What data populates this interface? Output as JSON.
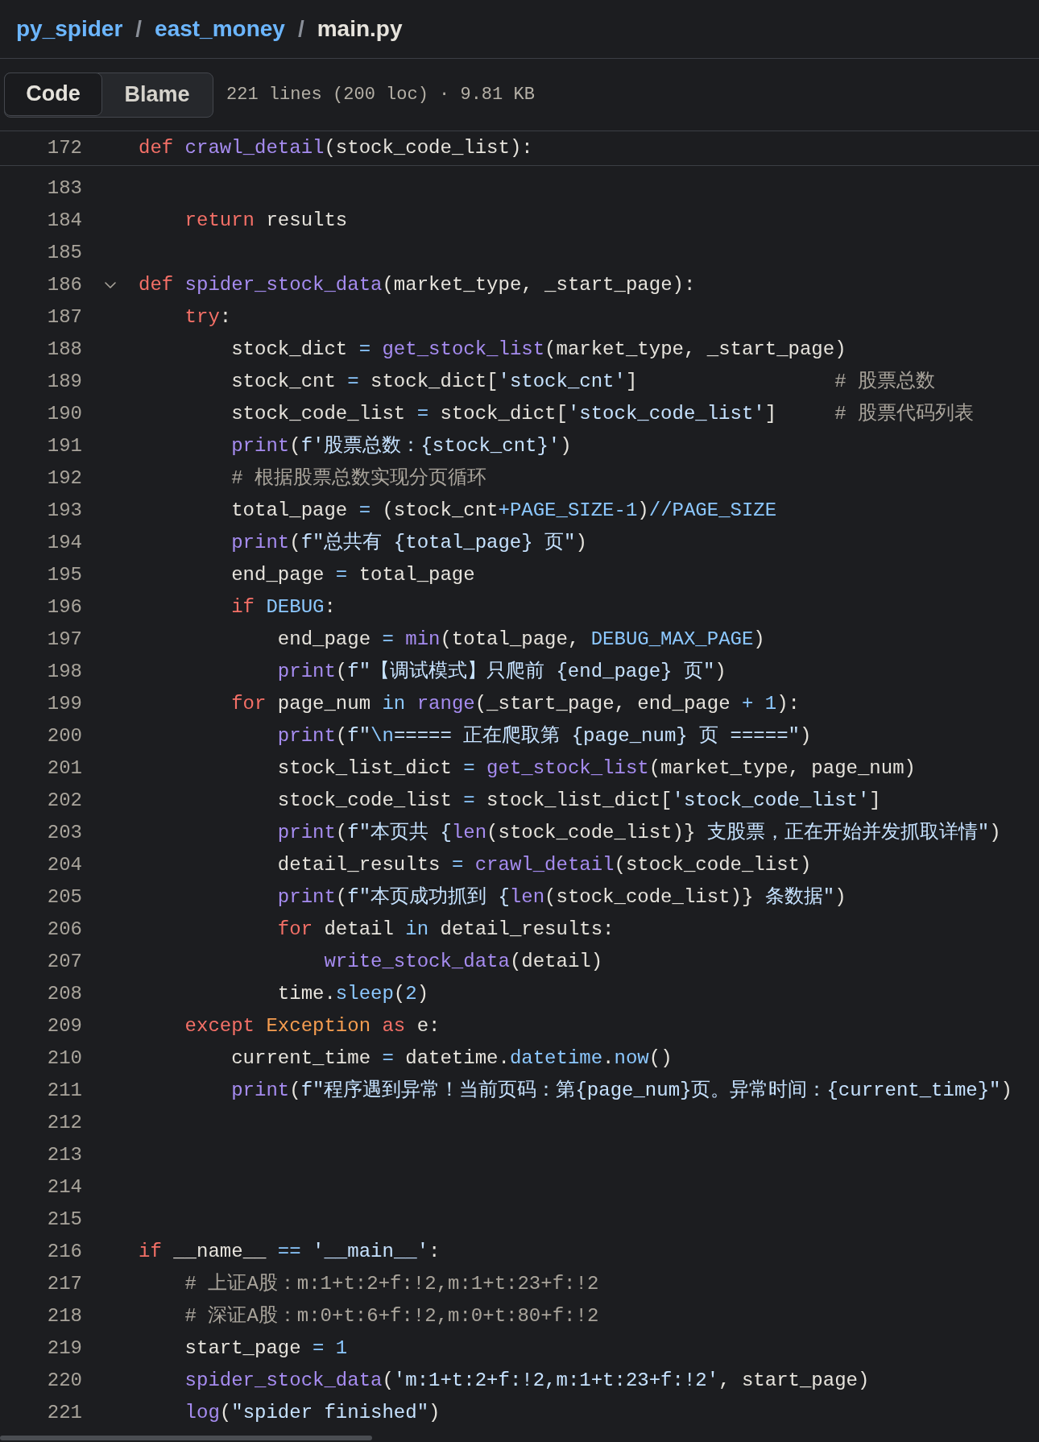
{
  "breadcrumb": [
    {
      "kind": "link",
      "label": "py_spider"
    },
    {
      "kind": "separator",
      "label": "/"
    },
    {
      "kind": "link",
      "label": "east_money"
    },
    {
      "kind": "separator",
      "label": "/"
    },
    {
      "kind": "current",
      "label": "main.py"
    }
  ],
  "view_tabs": [
    {
      "label": "Code",
      "selected": true
    },
    {
      "label": "Blame",
      "selected": false
    }
  ],
  "file_info": "221 lines (200 loc) · 9.81 KB",
  "sticky_line": {
    "number": "172",
    "tokens": [
      {
        "kind": "k",
        "text": "def"
      },
      {
        "kind": "f",
        "text": " crawl_detail"
      },
      {
        "kind": "p",
        "text": "(stock_code_list):"
      }
    ]
  },
  "lines": [
    {
      "number": "183"
    },
    {
      "number": "184",
      "tokens": [
        {
          "kind": "k",
          "text": "    return"
        },
        {
          "kind": "p",
          "text": " results"
        }
      ]
    },
    {
      "number": "185"
    },
    {
      "number": "186",
      "expanded": true,
      "tokens": [
        {
          "kind": "k",
          "text": "def"
        },
        {
          "kind": "f",
          "text": " spider_stock_data"
        },
        {
          "kind": "p",
          "text": "(market_type, _start_page):"
        }
      ]
    },
    {
      "number": "187",
      "tokens": [
        {
          "kind": "k",
          "text": "    try"
        },
        {
          "kind": "p",
          "text": ":"
        }
      ]
    },
    {
      "number": "188",
      "tokens": [
        {
          "kind": "p",
          "text": "        stock_dict "
        },
        {
          "kind": "c",
          "text": "="
        },
        {
          "kind": "f",
          "text": " get_stock_list"
        },
        {
          "kind": "p",
          "text": "(market_type, _start_page)"
        }
      ]
    },
    {
      "number": "189",
      "tokens": [
        {
          "kind": "p",
          "text": "        stock_cnt "
        },
        {
          "kind": "c",
          "text": "="
        },
        {
          "kind": "p",
          "text": " stock_dict["
        },
        {
          "kind": "s",
          "text": "'stock_cnt'"
        },
        {
          "kind": "p",
          "text": "]"
        },
        {
          "kind": "m",
          "text": "                 # 股票总数"
        }
      ]
    },
    {
      "number": "190",
      "tokens": [
        {
          "kind": "p",
          "text": "        stock_code_list "
        },
        {
          "kind": "c",
          "text": "="
        },
        {
          "kind": "p",
          "text": " stock_dict["
        },
        {
          "kind": "s",
          "text": "'stock_code_list'"
        },
        {
          "kind": "p",
          "text": "]"
        },
        {
          "kind": "m",
          "text": "     # 股票代码列表"
        }
      ]
    },
    {
      "number": "191",
      "tokens": [
        {
          "kind": "f",
          "text": "        print"
        },
        {
          "kind": "p",
          "text": "("
        },
        {
          "kind": "s",
          "text": "f'股票总数：{stock_cnt}'"
        },
        {
          "kind": "p",
          "text": ")"
        }
      ]
    },
    {
      "number": "192",
      "tokens": [
        {
          "kind": "m",
          "text": "        # 根据股票总数实现分页循环"
        }
      ]
    },
    {
      "number": "193",
      "tokens": [
        {
          "kind": "p",
          "text": "        total_page "
        },
        {
          "kind": "c",
          "text": "="
        },
        {
          "kind": "p",
          "text": " (stock_cnt"
        },
        {
          "kind": "c",
          "text": "+PAGE_SIZE-1"
        },
        {
          "kind": "p",
          "text": ")"
        },
        {
          "kind": "c",
          "text": "//PAGE_SIZE"
        }
      ]
    },
    {
      "number": "194",
      "tokens": [
        {
          "kind": "f",
          "text": "        print"
        },
        {
          "kind": "p",
          "text": "("
        },
        {
          "kind": "s",
          "text": "f\"总共有 {total_page} 页\""
        },
        {
          "kind": "p",
          "text": ")"
        }
      ]
    },
    {
      "number": "195",
      "tokens": [
        {
          "kind": "p",
          "text": "        end_page "
        },
        {
          "kind": "c",
          "text": "="
        },
        {
          "kind": "p",
          "text": " total_page"
        }
      ]
    },
    {
      "number": "196",
      "tokens": [
        {
          "kind": "k",
          "text": "        if"
        },
        {
          "kind": "c",
          "text": " DEBUG"
        },
        {
          "kind": "p",
          "text": ":"
        }
      ]
    },
    {
      "number": "197",
      "tokens": [
        {
          "kind": "p",
          "text": "            end_page "
        },
        {
          "kind": "c",
          "text": "="
        },
        {
          "kind": "f",
          "text": " min"
        },
        {
          "kind": "p",
          "text": "(total_page, "
        },
        {
          "kind": "c",
          "text": "DEBUG_MAX_PAGE"
        },
        {
          "kind": "p",
          "text": ")"
        }
      ]
    },
    {
      "number": "198",
      "tokens": [
        {
          "kind": "f",
          "text": "            print"
        },
        {
          "kind": "p",
          "text": "("
        },
        {
          "kind": "s",
          "text": "f\"【调试模式】只爬前 {end_page} 页\""
        },
        {
          "kind": "p",
          "text": ")"
        }
      ]
    },
    {
      "number": "199",
      "tokens": [
        {
          "kind": "k",
          "text": "        for"
        },
        {
          "kind": "p",
          "text": " page_num "
        },
        {
          "kind": "c",
          "text": "in"
        },
        {
          "kind": "f",
          "text": " range"
        },
        {
          "kind": "p",
          "text": "(_start_page, end_page "
        },
        {
          "kind": "c",
          "text": "+ 1"
        },
        {
          "kind": "p",
          "text": "):"
        }
      ]
    },
    {
      "number": "200",
      "tokens": [
        {
          "kind": "f",
          "text": "            print"
        },
        {
          "kind": "p",
          "text": "("
        },
        {
          "kind": "s",
          "text": "f\""
        },
        {
          "kind": "c",
          "text": "\\n"
        },
        {
          "kind": "s",
          "text": "===== 正在爬取第 {page_num} 页 =====\""
        },
        {
          "kind": "p",
          "text": ")"
        }
      ]
    },
    {
      "number": "201",
      "tokens": [
        {
          "kind": "p",
          "text": "            stock_list_dict "
        },
        {
          "kind": "c",
          "text": "="
        },
        {
          "kind": "f",
          "text": " get_stock_list"
        },
        {
          "kind": "p",
          "text": "(market_type, page_num)"
        }
      ]
    },
    {
      "number": "202",
      "tokens": [
        {
          "kind": "p",
          "text": "            stock_code_list "
        },
        {
          "kind": "c",
          "text": "="
        },
        {
          "kind": "p",
          "text": " stock_list_dict["
        },
        {
          "kind": "s",
          "text": "'stock_code_list'"
        },
        {
          "kind": "p",
          "text": "]"
        }
      ]
    },
    {
      "number": "203",
      "tokens": [
        {
          "kind": "f",
          "text": "            print"
        },
        {
          "kind": "p",
          "text": "("
        },
        {
          "kind": "s",
          "text": "f\"本页共 {"
        },
        {
          "kind": "f",
          "text": "len"
        },
        {
          "kind": "p",
          "text": "(stock_code_list)}"
        },
        {
          "kind": "s",
          "text": " 支股票，正在开始并发抓取详情\""
        },
        {
          "kind": "p",
          "text": ")"
        }
      ]
    },
    {
      "number": "204",
      "tokens": [
        {
          "kind": "p",
          "text": "            detail_results "
        },
        {
          "kind": "c",
          "text": "="
        },
        {
          "kind": "f",
          "text": " crawl_detail"
        },
        {
          "kind": "p",
          "text": "(stock_code_list)"
        }
      ]
    },
    {
      "number": "205",
      "tokens": [
        {
          "kind": "f",
          "text": "            print"
        },
        {
          "kind": "p",
          "text": "("
        },
        {
          "kind": "s",
          "text": "f\"本页成功抓到 {"
        },
        {
          "kind": "f",
          "text": "len"
        },
        {
          "kind": "p",
          "text": "(stock_code_list)}"
        },
        {
          "kind": "s",
          "text": " 条数据\""
        },
        {
          "kind": "p",
          "text": ")"
        }
      ]
    },
    {
      "number": "206",
      "tokens": [
        {
          "kind": "k",
          "text": "            for"
        },
        {
          "kind": "p",
          "text": " detail "
        },
        {
          "kind": "c",
          "text": "in"
        },
        {
          "kind": "p",
          "text": " detail_results:"
        }
      ]
    },
    {
      "number": "207",
      "tokens": [
        {
          "kind": "f",
          "text": "                write_stock_data"
        },
        {
          "kind": "p",
          "text": "(detail)"
        }
      ]
    },
    {
      "number": "208",
      "tokens": [
        {
          "kind": "p",
          "text": "            time."
        },
        {
          "kind": "c",
          "text": "sleep"
        },
        {
          "kind": "p",
          "text": "("
        },
        {
          "kind": "c",
          "text": "2"
        },
        {
          "kind": "p",
          "text": ")"
        }
      ]
    },
    {
      "number": "209",
      "tokens": [
        {
          "kind": "k",
          "text": "    except"
        },
        {
          "kind": "o",
          "text": " Exception"
        },
        {
          "kind": "k",
          "text": " as"
        },
        {
          "kind": "p",
          "text": " e:"
        }
      ]
    },
    {
      "number": "210",
      "tokens": [
        {
          "kind": "p",
          "text": "        current_time "
        },
        {
          "kind": "c",
          "text": "="
        },
        {
          "kind": "p",
          "text": " datetime."
        },
        {
          "kind": "c",
          "text": "datetime"
        },
        {
          "kind": "p",
          "text": "."
        },
        {
          "kind": "c",
          "text": "now"
        },
        {
          "kind": "p",
          "text": "()"
        }
      ]
    },
    {
      "number": "211",
      "tokens": [
        {
          "kind": "f",
          "text": "        print"
        },
        {
          "kind": "p",
          "text": "("
        },
        {
          "kind": "s",
          "text": "f\"程序遇到异常！当前页码：第{page_num}页。异常时间：{current_time}\""
        },
        {
          "kind": "p",
          "text": ")"
        }
      ]
    },
    {
      "number": "212"
    },
    {
      "number": "213"
    },
    {
      "number": "214"
    },
    {
      "number": "215"
    },
    {
      "number": "216",
      "tokens": [
        {
          "kind": "k",
          "text": "if"
        },
        {
          "kind": "p",
          "text": " __name__ "
        },
        {
          "kind": "c",
          "text": "=="
        },
        {
          "kind": "s",
          "text": " '__main__'"
        },
        {
          "kind": "p",
          "text": ":"
        }
      ]
    },
    {
      "number": "217",
      "tokens": [
        {
          "kind": "m",
          "text": "    # 上证A股：m:1+t:2+f:!2,m:1+t:23+f:!2"
        }
      ]
    },
    {
      "number": "218",
      "tokens": [
        {
          "kind": "m",
          "text": "    # 深证A股：m:0+t:6+f:!2,m:0+t:80+f:!2"
        }
      ]
    },
    {
      "number": "219",
      "tokens": [
        {
          "kind": "p",
          "text": "    start_page "
        },
        {
          "kind": "c",
          "text": "= 1"
        }
      ]
    },
    {
      "number": "220",
      "tokens": [
        {
          "kind": "f",
          "text": "    spider_stock_data"
        },
        {
          "kind": "p",
          "text": "("
        },
        {
          "kind": "s",
          "text": "'m:1+t:2+f:!2,m:1+t:23+f:!2'"
        },
        {
          "kind": "p",
          "text": ", start_page)"
        }
      ]
    },
    {
      "number": "221",
      "tokens": [
        {
          "kind": "f",
          "text": "    log"
        },
        {
          "kind": "p",
          "text": "("
        },
        {
          "kind": "s",
          "text": "\"spider finished\""
        },
        {
          "kind": "p",
          "text": ")"
        }
      ]
    }
  ]
}
